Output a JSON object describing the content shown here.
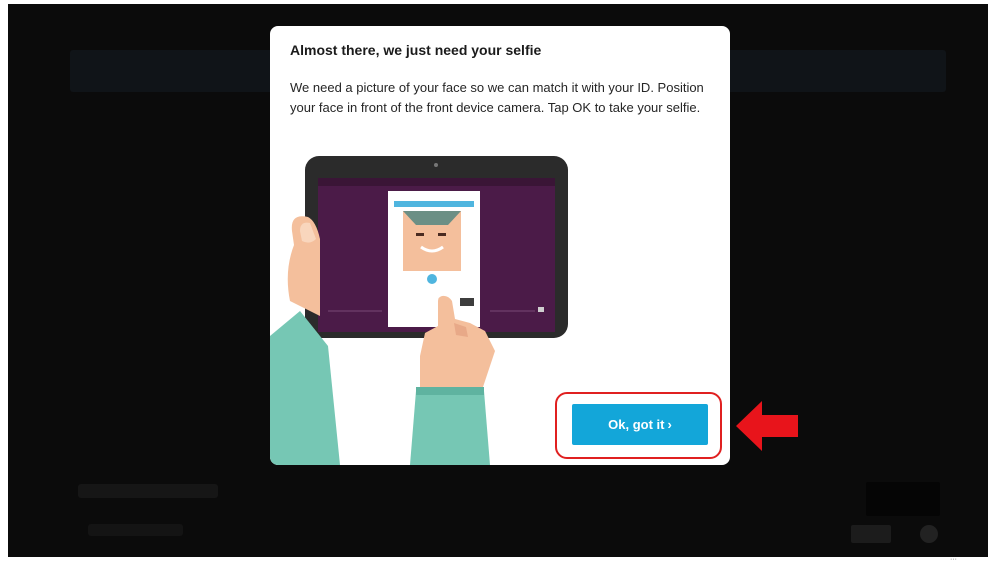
{
  "dialog": {
    "title": "Almost there, we just need your selfie",
    "body": "We need a picture of your face so we can match it with your ID. Position your face in front of the front device camera. Tap OK to take your selfie.",
    "ok_button": {
      "label": "Ok, got it",
      "chevron": "›"
    }
  },
  "icons": {
    "illustration": "tablet-selfie-illustration",
    "arrow": "red-arrow-left-icon",
    "chevron": "chevron-right-icon"
  },
  "colors": {
    "ok_button": "#13a6d9",
    "highlight": "#e02020",
    "tablet_screen": "#4b1b48",
    "sleeve": "#76c7b4",
    "skin": "#f4bf9c"
  }
}
